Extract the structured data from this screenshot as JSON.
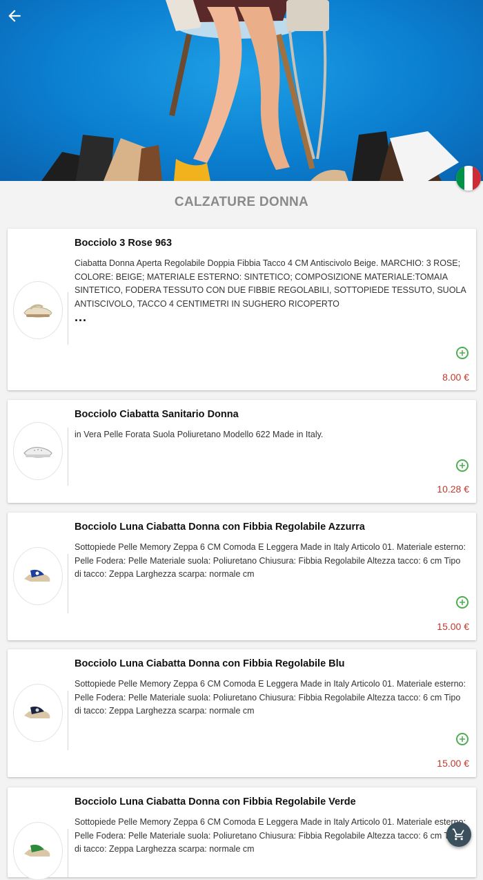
{
  "header": {
    "back_icon": "arrow-left-icon",
    "hero_image": "woman-sitting-with-shoes-photo",
    "flag": "italy-flag",
    "flag_colors": [
      "#009246",
      "#ffffff",
      "#ce2b37"
    ]
  },
  "page": {
    "title": "CALZATURE DONNA"
  },
  "products": [
    {
      "title": "Bocciolo 3 Rose 963",
      "description": "Ciabatta Donna Aperta Regolabile Doppia Fibbia Tacco 4 CM Antiscivolo Beige. MARCHIO: 3 ROSE; COLORE: BEIGE; MATERIALE ESTERNO: SINTETICO; COMPOSIZIONE MATERIALE:TOMAIA SINTETICO, FODERA TESSUTO CON DUE FIBBIE REGOLABILI, SOTTOPIEDE TESSUTO, SUOLA ANTISCIVOLO, TACCO 4 CENTIMETRI IN SUGHERO RICOPERTO",
      "more": "...",
      "price": "8.00 €",
      "shoe_color": "#e8dcc4"
    },
    {
      "title": "Bocciolo Ciabatta Sanitario Donna",
      "description": "in Vera Pelle Forata Suola Poliuretano Modello 622 Made in Italy.",
      "price": "10.28 €",
      "shoe_color": "#e6e6e6"
    },
    {
      "title": "Bocciolo Luna Ciabatta Donna con Fibbia Regolabile Azzurra",
      "description": "Sottopiede Pelle Memory Zeppa 6 CM Comoda E Leggera Made in Italy Articolo 01. Materiale esterno: Pelle Fodera: Pelle Materiale suola: Poliuretano Chiusura: Fibbia Regolabile Altezza tacco: 6 cm Tipo di tacco: Zeppa Larghezza scarpa: normale cm",
      "price": "15.00 €",
      "shoe_color": "#1d3f9e"
    },
    {
      "title": "Bocciolo Luna Ciabatta Donna con Fibbia Regolabile Blu",
      "description": "Sottopiede Pelle Memory Zeppa 6 CM Comoda E Leggera Made in Italy Articolo 01. Materiale esterno: Pelle Fodera: Pelle Materiale suola: Poliuretano Chiusura: Fibbia Regolabile Altezza tacco: 6 cm Tipo di tacco: Zeppa Larghezza scarpa: normale cm",
      "price": "15.00 €",
      "shoe_color": "#1b2440"
    },
    {
      "title": "Bocciolo Luna Ciabatta Donna con Fibbia Regolabile Verde",
      "description": "Sottopiede Pelle Memory Zeppa 6 CM Comoda E Leggera Made in Italy Articolo 01. Materiale esterno: Pelle Fodera: Pelle Materiale suola: Poliuretano Chiusura: Fibbia Regolabile Altezza tacco: 6 cm Tipo di tacco: Zeppa Larghezza scarpa: normale cm",
      "price": "",
      "shoe_color": "#2e8b3e"
    }
  ],
  "colors": {
    "accent_green": "#4caf50",
    "price_red": "#c0392b",
    "fab": "#3c4f5c"
  },
  "cart": {
    "icon": "shopping-cart-icon"
  }
}
